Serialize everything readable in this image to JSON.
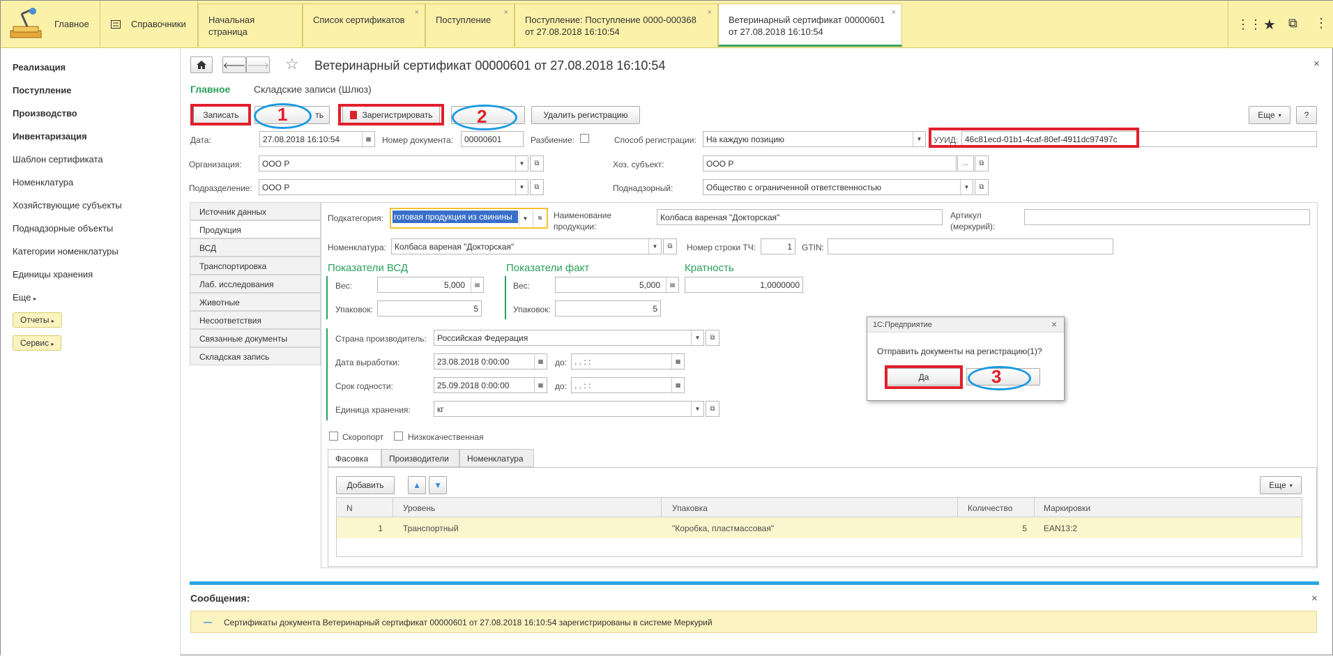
{
  "topbar": {
    "home_label": "Главное",
    "refs_label": "Справочники",
    "tabs": [
      {
        "label": "Начальная страница",
        "line2": ""
      },
      {
        "label": "Список сертификатов",
        "line2": ""
      },
      {
        "label": "Поступление",
        "line2": ""
      },
      {
        "label": "Поступление: Поступление 0000-000368",
        "line2": "от 27.08.2018 16:10:54"
      },
      {
        "label": "Ветеринарный сертификат 00000601",
        "line2": "от 27.08.2018 16:10:54"
      }
    ],
    "close_mark": "×"
  },
  "sidebar": {
    "items": [
      "Реализация",
      "Поступление",
      "Производство",
      "Инвентаризация",
      "Шаблон сертификата",
      "Номенклатура",
      "Хозяйствующие субъекты",
      "Поднадзорные объекты",
      "Категории номенклатуры",
      "Единицы хранения",
      "Еще"
    ],
    "reports": "Отчеты",
    "service": "Сервис"
  },
  "header": {
    "title": "Ветеринарный сертификат 00000601 от 27.08.2018 16:10:54",
    "subtab_main": "Главное",
    "subtab_stock": "Складские записи (Шлюз)"
  },
  "toolbar": {
    "save": "Записать",
    "save_close": "ть",
    "register": "Зарегистрировать",
    "unregister": "Удалить регистрацию",
    "more": "Еще",
    "help": "?"
  },
  "annotations": {
    "n1": "1",
    "n2": "2",
    "n3": "3"
  },
  "form": {
    "date_label": "Дата:",
    "date": "27.08.2018 16:10:54",
    "docnum_label": "Номер документа:",
    "docnum": "00000601",
    "split_label": "Разбиение:",
    "regmode_label": "Способ регистрации:",
    "regmode": "На каждую позицию",
    "uuid_label": "УУИД:",
    "uuid": "46c81ecd-01b1-4caf-80ef-4911dc97497c",
    "org_label": "Организация:",
    "org": "ООО Р",
    "bizsubj_label": "Хоз. субъект:",
    "bizsubj": "ООО  Р",
    "dept_label": "Подразделение:",
    "dept": "ООО Р",
    "supervised_label": "Поднадзорный:",
    "supervised": "Общество с ограниченной ответственностью",
    "ellipsis": "..."
  },
  "panel_tabs": [
    "Источник данных",
    "Продукция",
    "ВСД",
    "Транспортировка",
    "Лаб. исследования",
    "Животные",
    "Несоответствия",
    "Связанные документы",
    "Складская запись"
  ],
  "product": {
    "subcat_label": "Подкатегория:",
    "subcat": "готовая продукция из свинины",
    "name_label_1": "Наименование",
    "name_label_2": "продукции:",
    "name": "Колбаса вареная \"Докторская\"",
    "article_label_1": "Артикул",
    "article_label_2": "(меркурий):",
    "article": "",
    "nomen_label": "Номенклатура:",
    "nomen": "Колбаса вареная \"Докторская\"",
    "rownum_label": "Номер строки ТЧ:",
    "rownum": "1",
    "gtin_label": "GTIN:",
    "gtin": "",
    "vsd_section": "Показатели ВСД",
    "fact_section": "Показатели факт",
    "mult_section": "Кратность",
    "weight_label": "Вес:",
    "vsd_weight": "5,000",
    "fact_weight": "5,000",
    "multiplicity": "1,0000000",
    "packs_label": "Упаковок:",
    "vsd_packs": "5",
    "fact_packs": "5",
    "country_label": "Страна производитель:",
    "country": "Российская Федерация",
    "prod_date_label": "Дата выработки:",
    "prod_date": "23.08.2018  0:00:00",
    "expiry_label": "Срок годности:",
    "expiry": "25.09.2018  0:00:00",
    "to_label": "до:",
    "empty_date": " .  .     :  :",
    "unit_label": "Единица хранения:",
    "unit": "кг",
    "perishable": "Скоропорт",
    "lowquality": "Низкокачественная"
  },
  "inner_tabs": [
    "Фасовка",
    "Производители",
    "Номенклатура"
  ],
  "table": {
    "add": "Добавить",
    "more": "Еще",
    "headers": [
      "N",
      "Уровень",
      "Упаковка",
      "Количество",
      "Маркировки"
    ],
    "rows": [
      [
        "1",
        "Транспортный",
        "\"Коробка, пластмассовая\"",
        "5",
        "EAN13:2"
      ]
    ]
  },
  "messages": {
    "title": "Сообщения:",
    "dash": "—",
    "text": "Сертификаты документа Ветеринарный сертификат 00000601 от 27.08.2018 16:10:54 зарегистрированы в системе Меркурий"
  },
  "dialog": {
    "title": "1С:Предприятие",
    "question": "Отправить документы на регистрацию(1)?",
    "yes": "Да",
    "no": ""
  }
}
